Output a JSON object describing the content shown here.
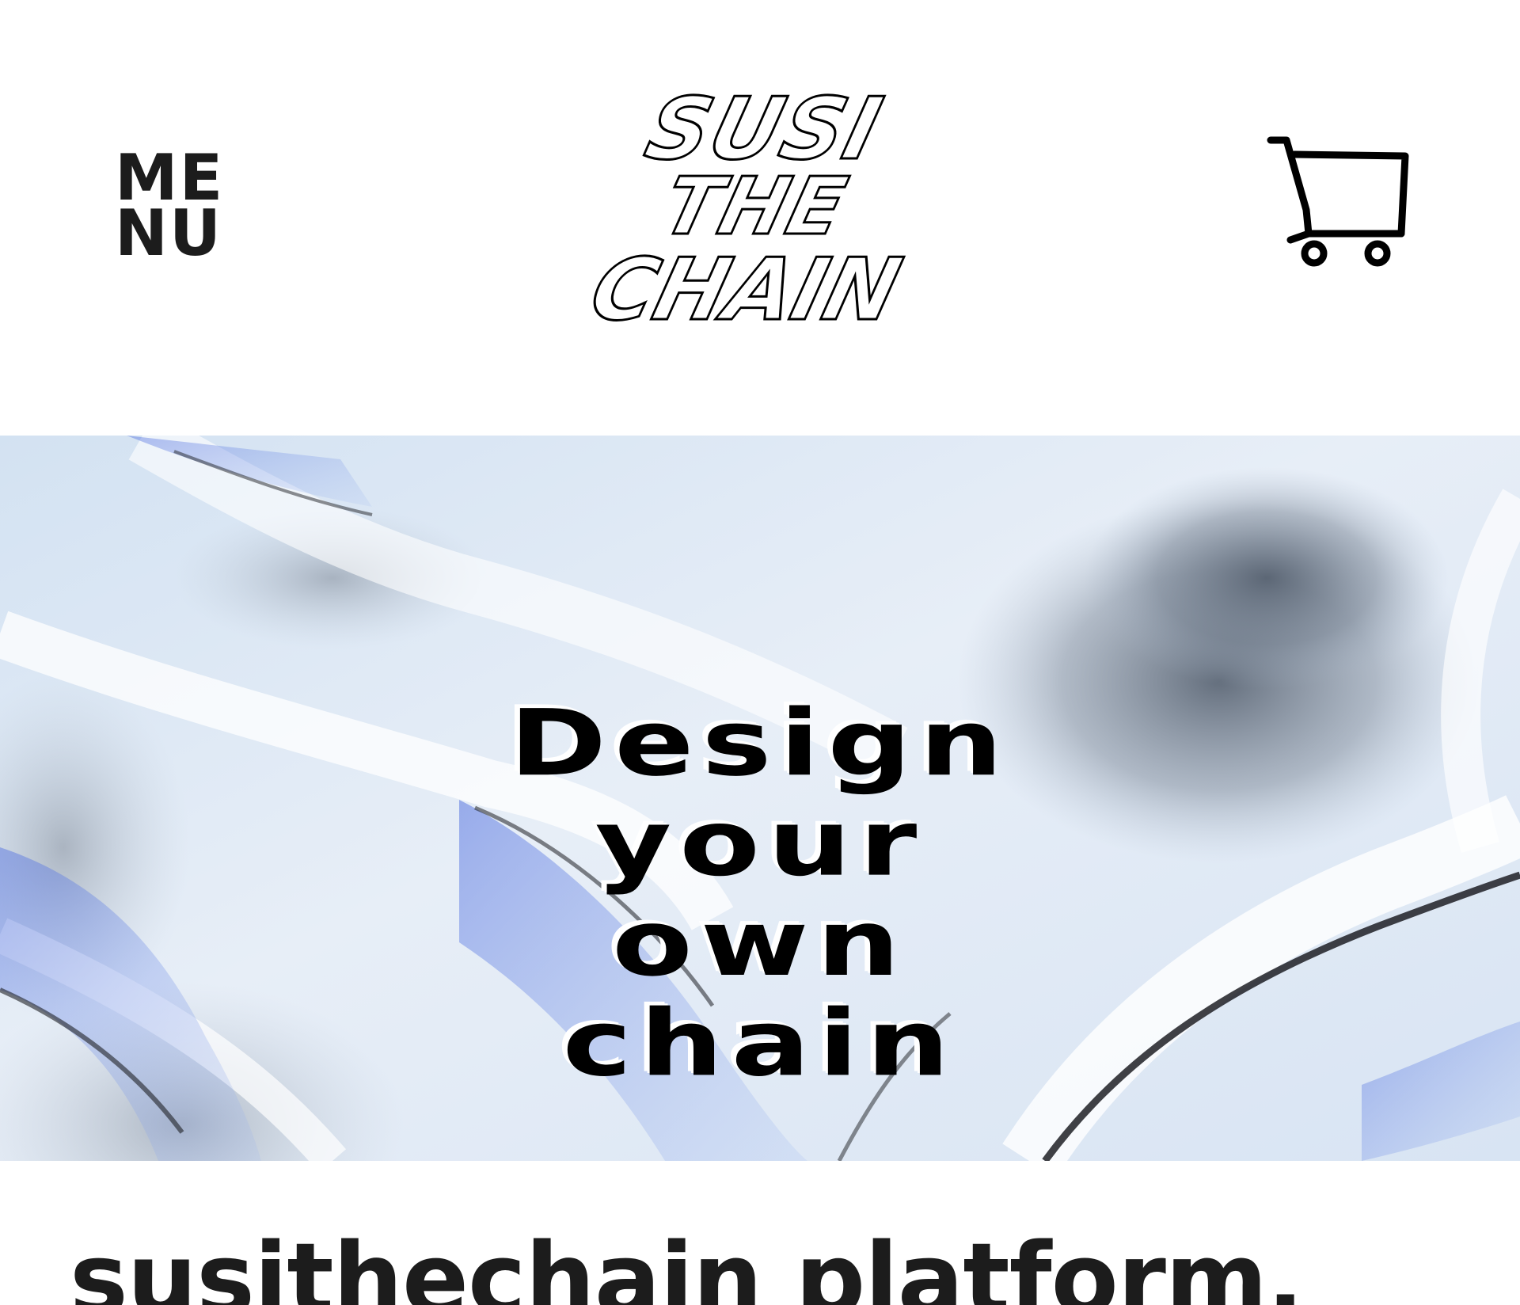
{
  "header": {
    "menu_line1": "ME",
    "menu_line2": "NU",
    "logo_line1": "SUSI",
    "logo_line2": "THE",
    "logo_line3": "CHAIN",
    "cart_icon": "shopping-cart-icon"
  },
  "hero": {
    "title_line1": "Design",
    "title_line2": "your",
    "title_line3": "own",
    "title_line4": "chain"
  },
  "content": {
    "heading": "susithechain platform."
  },
  "colors": {
    "text": "#1c1c1c",
    "background": "#ffffff",
    "hero_accent": "#3f5fd9"
  }
}
